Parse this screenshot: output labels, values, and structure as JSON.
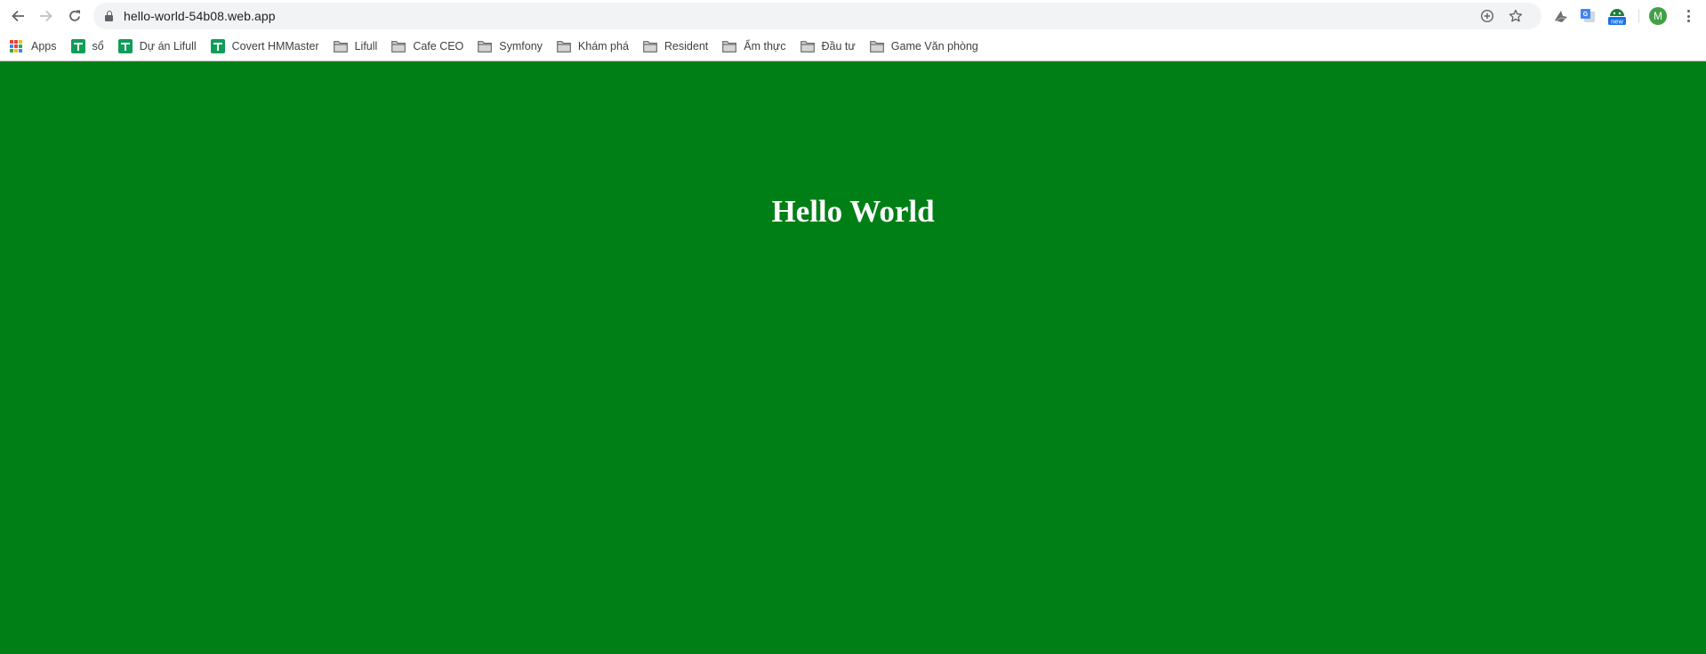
{
  "browser": {
    "nav": {
      "back_icon": "arrow-left-icon",
      "forward_icon": "arrow-right-icon",
      "reload_icon": "reload-icon"
    },
    "omnibox": {
      "security_icon": "lock-icon",
      "url": "hello-world-54b08.web.app",
      "install_icon": "plus-circle-icon",
      "bookmark_icon": "star-icon"
    },
    "extensions": [
      {
        "name": "shark-extension-icon"
      },
      {
        "name": "google-translate-icon"
      },
      {
        "name": "new-badge-extension-icon",
        "badge": "new"
      }
    ],
    "profile": {
      "initial": "M",
      "color": "#43a047"
    },
    "menu_icon": "more-vertical-icon"
  },
  "bookmarks": [
    {
      "label": "Apps",
      "icon": "apps-grid-icon"
    },
    {
      "label": "sổ",
      "icon": "google-sheets-icon"
    },
    {
      "label": "Dự án Lifull",
      "icon": "google-sheets-icon"
    },
    {
      "label": "Covert HMMaster",
      "icon": "google-sheets-icon"
    },
    {
      "label": "Lifull",
      "icon": "folder-icon"
    },
    {
      "label": "Cafe CEO",
      "icon": "folder-icon"
    },
    {
      "label": "Symfony",
      "icon": "folder-icon"
    },
    {
      "label": "Khám phá",
      "icon": "folder-icon"
    },
    {
      "label": "Resident",
      "icon": "folder-icon"
    },
    {
      "label": "Ẩm thực",
      "icon": "folder-icon"
    },
    {
      "label": "Đầu tư",
      "icon": "folder-icon"
    },
    {
      "label": "Game Văn phòng",
      "icon": "folder-icon"
    }
  ],
  "page": {
    "heading": "Hello World",
    "background_color": "#007f17",
    "text_color": "#ffffff"
  }
}
